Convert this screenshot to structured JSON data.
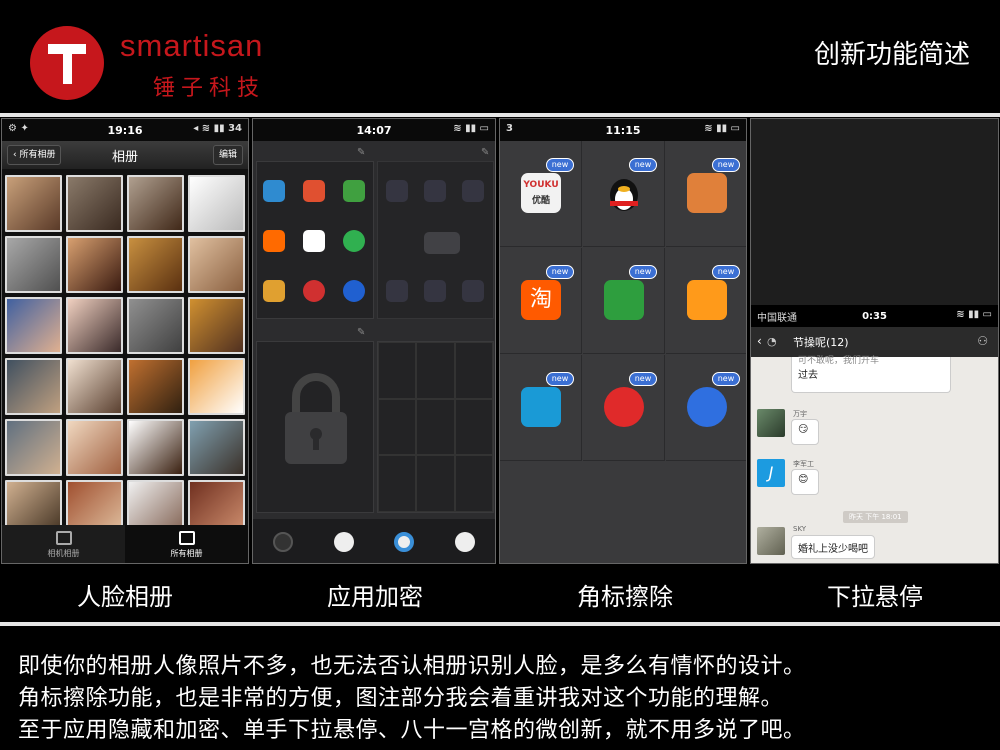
{
  "header": {
    "brand_en": "smartisan",
    "brand_cn": "锤子科技",
    "logo_glyph": "T",
    "title": "创新功能简述",
    "brand_color": "#c6171c"
  },
  "panels": {
    "album": {
      "time": "19:16",
      "back_label": "所有相册",
      "title": "相册",
      "edit_label": "编辑",
      "battery": "34",
      "tab_camera": "相机相册",
      "tab_all": "所有相册"
    },
    "encrypt": {
      "time": "14:07"
    },
    "badges": {
      "time": "11:15",
      "notification_count": "3",
      "badge_label": "new",
      "youku_label": "优酷"
    },
    "pulldown": {
      "carrier": "中国联通",
      "time": "0:35",
      "group_name": "节操呢(12)",
      "msg_partial_top": "可不敢呢，我们开车",
      "msg_top_end": "过去",
      "nick1": "万宇",
      "nick2": "李军工",
      "timestamp": "昨天 下午 18:01",
      "nick3": "SKY",
      "msg_last": "婚礼上没少喝吧"
    }
  },
  "captions": [
    "人脸相册",
    "应用加密",
    "角标擦除",
    "下拉悬停"
  ],
  "description": [
    "即使你的相册人像照片不多，也无法否认相册识别人脸，是多么有情怀的设计。",
    "角标擦除功能，也是非常的方便，图注部分我会着重讲我对这个功能的理解。",
    "至于应用隐藏和加密、单手下拉悬停、八十一宫格的微创新，就不用多说了吧。"
  ]
}
